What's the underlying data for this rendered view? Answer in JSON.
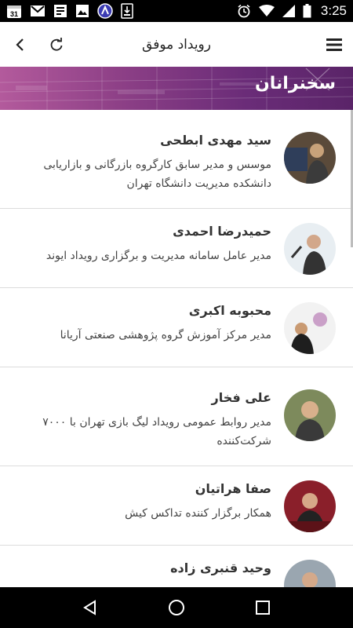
{
  "status_bar": {
    "time": "3:25",
    "calendar_day": "31",
    "icons_left": [
      "calendar-icon",
      "gmail-icon",
      "news-icon",
      "image-icon",
      "app-badge-icon",
      "download-icon"
    ],
    "icons_right": [
      "alarm-icon",
      "wifi-icon",
      "signal-icon",
      "battery-icon"
    ]
  },
  "app_bar": {
    "title": "رویداد موفق",
    "icons": [
      "back-arrow-icon",
      "refresh-icon",
      "menu-icon"
    ]
  },
  "banner": {
    "title": "سخنرانان"
  },
  "speakers": [
    {
      "name": "سید مهدی ابطحی",
      "description": "موسس و مدیر سابق کارگروه بازرگانی و بازاریابی دانشکده مدیریت دانشگاه تهران",
      "avatar_palette": [
        "#5a4a3a",
        "#2f3e5a",
        "#c8a27a"
      ]
    },
    {
      "name": "حمیدرضا احمدی",
      "description": "مدیر عامل سامانه مدیریت و برگزاری رویداد ایوند",
      "avatar_palette": [
        "#e8eef2",
        "#333333",
        "#d2a78a"
      ]
    },
    {
      "name": "محبوبه اکبری",
      "description": "مدیر مرکز آموزش گروه پژوهشی صنعتی آریانا",
      "avatar_palette": [
        "#f2f2f2",
        "#1e1e1e",
        "#caa0c8"
      ]
    },
    {
      "name": "علی فخار",
      "description": "مدیر روابط عمومی رویداد لیگ بازی تهران با ۷۰۰۰ شرکت‌کننده",
      "avatar_palette": [
        "#7d8a5c",
        "#3a3a3a",
        "#d8b08c"
      ]
    },
    {
      "name": "صفا هراتیان",
      "description": "همکار برگزار کننده تداکس کیش",
      "avatar_palette": [
        "#8a1f2a",
        "#222222",
        "#d6a888"
      ]
    },
    {
      "name": "وحید قنبری زاده",
      "description": "",
      "avatar_palette": [
        "#9aa6b0",
        "#2a2a2a",
        "#d4a98a"
      ]
    }
  ],
  "nav_bar": {
    "icons": [
      "nav-back-icon",
      "nav-home-icon",
      "nav-recents-icon"
    ]
  },
  "colors": {
    "banner_start": "#b35a9c",
    "banner_end": "#5a2468",
    "status_bar": "#000000",
    "divider": "#dcdcdc"
  }
}
